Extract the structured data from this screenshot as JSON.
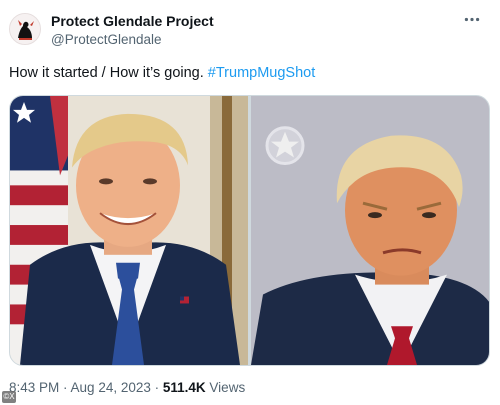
{
  "post": {
    "author_name": "Protect Glendale Project",
    "author_handle": "@ProtectGlendale",
    "text_prefix": "How it started / How it’s going. ",
    "hashtag": "#TrumpMugShot",
    "time": "8:43 PM",
    "separator": " · ",
    "date": "Aug 24, 2023",
    "views_count": "511.4K",
    "views_label": " Views"
  },
  "media": {
    "left_photo": "portrait-photo",
    "right_photo": "mugshot-photo"
  },
  "watermark": "©X",
  "colors": {
    "text_primary": "#0f1419",
    "text_secondary": "#536471",
    "hashtag": "#1d9bf0",
    "border": "#cfd9de"
  },
  "icons": {
    "avatar": "profile-avatar-icon",
    "more": "more-dots-icon"
  }
}
